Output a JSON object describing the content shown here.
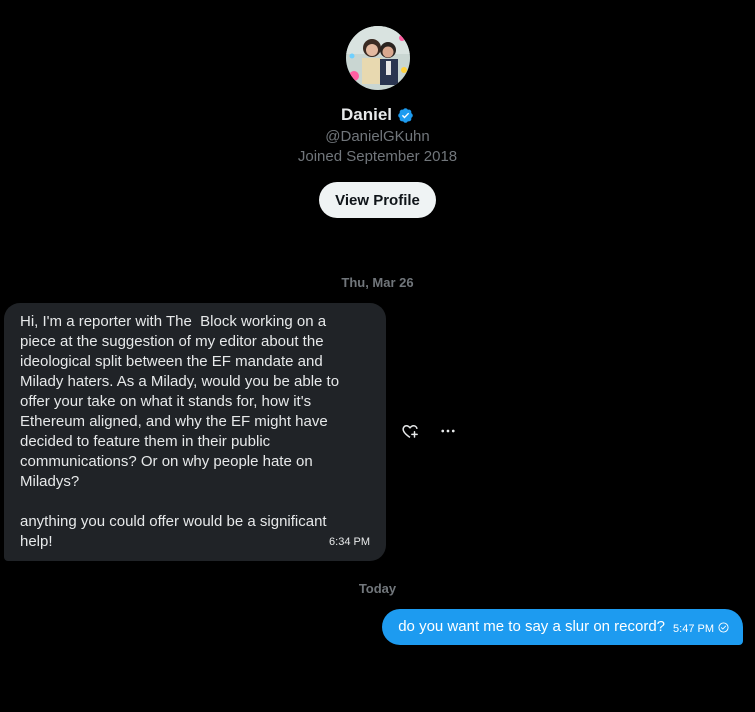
{
  "profile": {
    "name": "Daniel",
    "handle": "@DanielGKuhn",
    "joined": "Joined September 2018",
    "view_profile_label": "View Profile"
  },
  "conversation": {
    "date_separator_1": "Thu, Mar 26",
    "date_separator_2": "Today",
    "incoming_message": {
      "text": "Hi, I'm a reporter with The  Block working on a piece at the suggestion of my editor about the ideological split between the EF mandate and Milady haters. As a Milady, would you be able to offer your take on what it stands for, how it's Ethereum aligned, and why the EF might have decided to feature them in their public communications? Or on why people hate on Miladys?\n\nanything you could offer would be a significant help!",
      "time": "6:34 PM"
    },
    "outgoing_message": {
      "text": "do you want me to say a slur on record?",
      "time": "5:47 PM"
    }
  },
  "icons": {
    "verified": "verified-badge-icon",
    "react": "heart-plus-icon",
    "more": "more-dots-icon",
    "status": "sent-check-icon"
  },
  "colors": {
    "background": "#000000",
    "incoming_bubble": "#202327",
    "outgoing_bubble": "#1d9bf0",
    "verified": "#1d9bf0",
    "muted_text": "#71767b"
  }
}
